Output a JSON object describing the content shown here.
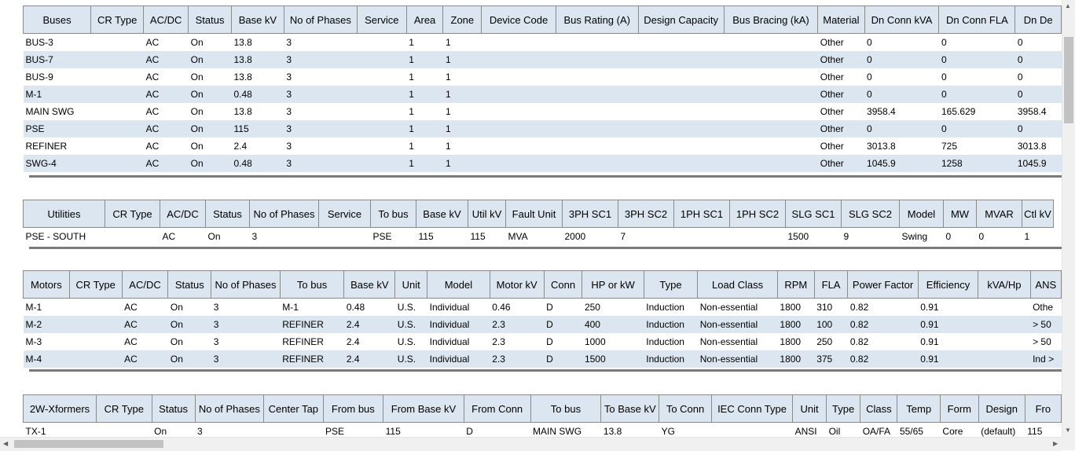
{
  "buses": {
    "columns": [
      "Buses",
      "CR Type",
      "AC/DC",
      "Status",
      "Base kV",
      "No of Phases",
      "Service",
      "Area",
      "Zone",
      "Device Code",
      "Bus Rating (A)",
      "Design Capacity",
      "Bus Bracing (kA)",
      "Material",
      "Dn Conn kVA",
      "Dn Conn FLA",
      "Dn De"
    ],
    "rows": [
      [
        "BUS-3",
        "",
        "AC",
        "On",
        "13.8",
        "3",
        "",
        "1",
        "1",
        "",
        "",
        "",
        "",
        "Other",
        "0",
        "0",
        "0"
      ],
      [
        "BUS-7",
        "",
        "AC",
        "On",
        "13.8",
        "3",
        "",
        "1",
        "1",
        "",
        "",
        "",
        "",
        "Other",
        "0",
        "0",
        "0"
      ],
      [
        "BUS-9",
        "",
        "AC",
        "On",
        "13.8",
        "3",
        "",
        "1",
        "1",
        "",
        "",
        "",
        "",
        "Other",
        "0",
        "0",
        "0"
      ],
      [
        "M-1",
        "",
        "AC",
        "On",
        "0.48",
        "3",
        "",
        "1",
        "1",
        "",
        "",
        "",
        "",
        "Other",
        "0",
        "0",
        "0"
      ],
      [
        "MAIN SWG",
        "",
        "AC",
        "On",
        "13.8",
        "3",
        "",
        "1",
        "1",
        "",
        "",
        "",
        "",
        "Other",
        "3958.4",
        "165.629",
        "3958.4"
      ],
      [
        "PSE",
        "",
        "AC",
        "On",
        "115",
        "3",
        "",
        "1",
        "1",
        "",
        "",
        "",
        "",
        "Other",
        "0",
        "0",
        "0"
      ],
      [
        "REFINER",
        "",
        "AC",
        "On",
        "2.4",
        "3",
        "",
        "1",
        "1",
        "",
        "",
        "",
        "",
        "Other",
        "3013.8",
        "725",
        "3013.8"
      ],
      [
        "SWG-4",
        "",
        "AC",
        "On",
        "0.48",
        "3",
        "",
        "1",
        "1",
        "",
        "",
        "",
        "",
        "Other",
        "1045.9",
        "1258",
        "1045.9"
      ]
    ]
  },
  "utilities": {
    "columns": [
      "Utilities",
      "CR Type",
      "AC/DC",
      "Status",
      "No of Phases",
      "Service",
      "To bus",
      "Base kV",
      "Util kV",
      "Fault Unit",
      "3PH SC1",
      "3PH SC2",
      "1PH SC1",
      "1PH SC2",
      "SLG SC1",
      "SLG SC2",
      "Model",
      "MW",
      "MVAR",
      "Ctl kV"
    ],
    "rows": [
      [
        "PSE - SOUTH",
        "",
        "AC",
        "On",
        "3",
        "",
        "PSE",
        "115",
        "115",
        "MVA",
        "2000",
        "7",
        "",
        "",
        "1500",
        "9",
        "Swing",
        "0",
        "0",
        "1"
      ]
    ]
  },
  "motors": {
    "columns": [
      "Motors",
      "CR Type",
      "AC/DC",
      "Status",
      "No of Phases",
      "To bus",
      "Base kV",
      "Unit",
      "Model",
      "Motor kV",
      "Conn",
      "HP or kW",
      "Type",
      "Load Class",
      "RPM",
      "FLA",
      "Power Factor",
      "Efficiency",
      "kVA/Hp",
      "ANS"
    ],
    "rows": [
      [
        "M-1",
        "",
        "AC",
        "On",
        "3",
        "M-1",
        "0.48",
        "U.S.",
        "Individual",
        "0.46",
        "D",
        "250",
        "Induction",
        "Non-essential",
        "1800",
        "310",
        "0.82",
        "0.91",
        "",
        "Othe"
      ],
      [
        "M-2",
        "",
        "AC",
        "On",
        "3",
        "REFINER",
        "2.4",
        "U.S.",
        "Individual",
        "2.3",
        "D",
        "400",
        "Induction",
        "Non-essential",
        "1800",
        "100",
        "0.82",
        "0.91",
        "",
        "> 50"
      ],
      [
        "M-3",
        "",
        "AC",
        "On",
        "3",
        "REFINER",
        "2.4",
        "U.S.",
        "Individual",
        "2.3",
        "D",
        "1000",
        "Induction",
        "Non-essential",
        "1800",
        "250",
        "0.82",
        "0.91",
        "",
        "> 50"
      ],
      [
        "M-4",
        "",
        "AC",
        "On",
        "3",
        "REFINER",
        "2.4",
        "U.S.",
        "Individual",
        "2.3",
        "D",
        "1500",
        "Induction",
        "Non-essential",
        "1800",
        "375",
        "0.82",
        "0.91",
        "",
        "Ind >"
      ]
    ]
  },
  "xformers": {
    "columns": [
      "2W-Xformers",
      "CR Type",
      "Status",
      "No of Phases",
      "Center Tap",
      "From bus",
      "From Base kV",
      "From Conn",
      "To bus",
      "To Base kV",
      "To Conn",
      "IEC Conn Type",
      "Unit",
      "Type",
      "Class",
      "Temp",
      "Form",
      "Design",
      "Fro"
    ],
    "rows": [
      [
        "TX-1",
        "",
        "On",
        "3",
        "",
        "PSE",
        "115",
        "D",
        "MAIN SWG",
        "13.8",
        "YG",
        "",
        "ANSI",
        "Oil",
        "OA/FA",
        "55/65",
        "Core",
        "(default)",
        "115"
      ]
    ]
  },
  "icons": {
    "up": "▲",
    "down": "▼",
    "left": "◀",
    "right": "▶"
  }
}
